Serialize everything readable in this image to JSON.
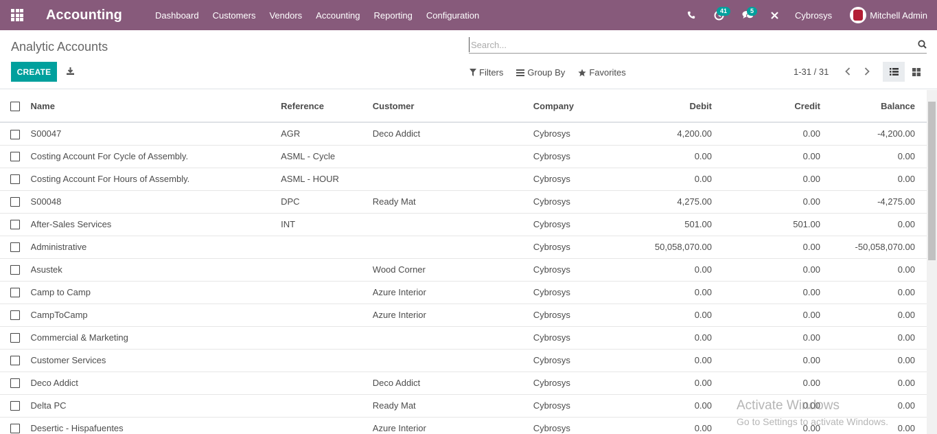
{
  "navbar": {
    "app_name": "Accounting",
    "menu": [
      "Dashboard",
      "Customers",
      "Vendors",
      "Accounting",
      "Reporting",
      "Configuration"
    ],
    "activity_count": "41",
    "message_count": "5",
    "company": "Cybrosys",
    "user": "Mitchell Admin"
  },
  "control_panel": {
    "title": "Analytic Accounts",
    "search_placeholder": "Search...",
    "create_label": "CREATE",
    "filters_label": "Filters",
    "groupby_label": "Group By",
    "favorites_label": "Favorites",
    "pager": "1-31 / 31"
  },
  "table": {
    "columns": [
      "Name",
      "Reference",
      "Customer",
      "Company",
      "Debit",
      "Credit",
      "Balance"
    ],
    "rows": [
      [
        "S00047",
        "AGR",
        "Deco Addict",
        "Cybrosys",
        "4,200.00",
        "0.00",
        "-4,200.00"
      ],
      [
        "Costing Account For Cycle of Assembly.",
        "ASML - Cycle",
        "",
        "Cybrosys",
        "0.00",
        "0.00",
        "0.00"
      ],
      [
        "Costing Account For Hours of Assembly.",
        "ASML - HOUR",
        "",
        "Cybrosys",
        "0.00",
        "0.00",
        "0.00"
      ],
      [
        "S00048",
        "DPC",
        "Ready Mat",
        "Cybrosys",
        "4,275.00",
        "0.00",
        "-4,275.00"
      ],
      [
        "After-Sales Services",
        "INT",
        "",
        "Cybrosys",
        "501.00",
        "501.00",
        "0.00"
      ],
      [
        "Administrative",
        "",
        "",
        "Cybrosys",
        "50,058,070.00",
        "0.00",
        "-50,058,070.00"
      ],
      [
        "Asustek",
        "",
        "Wood Corner",
        "Cybrosys",
        "0.00",
        "0.00",
        "0.00"
      ],
      [
        "Camp to Camp",
        "",
        "Azure Interior",
        "Cybrosys",
        "0.00",
        "0.00",
        "0.00"
      ],
      [
        "CampToCamp",
        "",
        "Azure Interior",
        "Cybrosys",
        "0.00",
        "0.00",
        "0.00"
      ],
      [
        "Commercial & Marketing",
        "",
        "",
        "Cybrosys",
        "0.00",
        "0.00",
        "0.00"
      ],
      [
        "Customer Services",
        "",
        "",
        "Cybrosys",
        "0.00",
        "0.00",
        "0.00"
      ],
      [
        "Deco Addict",
        "",
        "Deco Addict",
        "Cybrosys",
        "0.00",
        "0.00",
        "0.00"
      ],
      [
        "Delta PC",
        "",
        "Ready Mat",
        "Cybrosys",
        "0.00",
        "0.00",
        "0.00"
      ],
      [
        "Desertic - Hispafuentes",
        "",
        "Azure Interior",
        "Cybrosys",
        "0.00",
        "0.00",
        "0.00"
      ]
    ]
  },
  "watermark": {
    "line1": "Activate Windows",
    "line2": "Go to Settings to activate Windows."
  },
  "colors": {
    "navbar": "#875a7b",
    "primary": "#00a09d"
  }
}
